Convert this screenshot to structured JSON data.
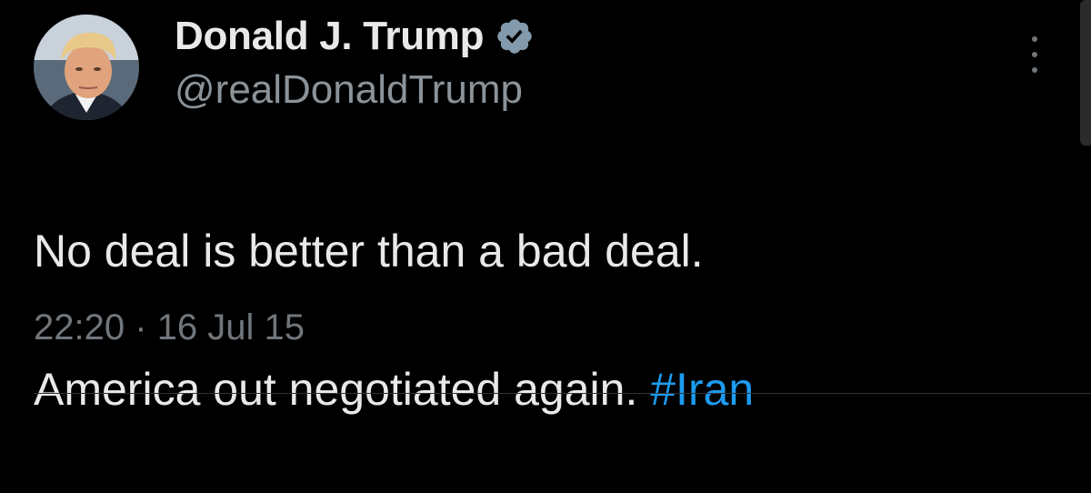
{
  "author": {
    "display_name": "Donald J. Trump",
    "handle": "@realDonaldTrump",
    "verified": true,
    "avatar_icon": "profile-photo"
  },
  "tweet": {
    "line1": "No deal is better than a bad deal.",
    "line2": "America out negotiated again.",
    "hashtag": "#Iran",
    "time": "22:20",
    "separator": "·",
    "date": "16 Jul 15"
  },
  "icons": {
    "verified_badge": "verified-badge-icon",
    "more_menu": "more-vertical-icon"
  },
  "colors": {
    "background": "#000000",
    "text_primary": "#e7e9ea",
    "text_secondary": "#71767b",
    "link": "#1d9bf0",
    "verified_badge": "#829aab"
  }
}
